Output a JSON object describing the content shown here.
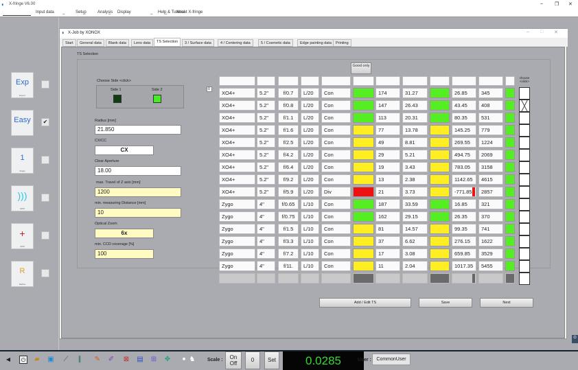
{
  "app": {
    "title": "X-fringe V6.00",
    "menu": [
      "Input data",
      "_",
      "Setup",
      "_",
      "Analysis",
      "_",
      "Display",
      "_",
      "Help & Tutorial",
      "_",
      "About X-fringe"
    ]
  },
  "window": {
    "title": "X-Job by XONOX",
    "tabs": [
      "Start",
      "General data",
      "Blank data",
      "Lens data",
      "TS Selection",
      "3 / Surface data",
      "4 / Centering data",
      "5 / Cosmetic data",
      "Edge painting data",
      "Printing"
    ],
    "active_tab": "TS Selection",
    "section": "TS Selection"
  },
  "tools": [
    {
      "label": "Exp",
      "sub": "Expert",
      "checked": false
    },
    {
      "label": "Easy",
      "sub": "",
      "checked": true
    },
    {
      "label": "1",
      "sub": "Single",
      "checked": false
    },
    {
      "label": "",
      "sub": "DPM",
      "checked": false
    },
    {
      "label": "+",
      "sub": "APM",
      "checked": false
    },
    {
      "label": "R",
      "sub": "Radius",
      "checked": false
    }
  ],
  "form": {
    "side_title": "Choose Side <click>",
    "side1": "Side 1",
    "side2": "Side 2",
    "selected_side": "Side 2",
    "radius_label": "Radius [mm]",
    "radius": "21.850",
    "cxcc_label": "CX/CC",
    "cxcc": "CX",
    "aperture_label": "Clear Aperture",
    "aperture": "18.00",
    "ztravel_label": "max. Travel of Z axis [mm]",
    "ztravel": "1200",
    "mindist_label": "min. measuring Distance [mm]",
    "mindist": "10",
    "zoom_label": "Optical Zoom",
    "zoom": "6x",
    "ccd_label": "min. CCD coverage [%]",
    "ccd": "100"
  },
  "table": {
    "good_only": "Good only",
    "choose_header": "choose <click>",
    "index": "0",
    "colors": {
      "G": "#55ee22",
      "Y": "#ffee22",
      "R": "#ee1111"
    },
    "rows": [
      [
        "XO4+",
        "5.2\"",
        "f/0.7",
        "L/20",
        "Con",
        "G",
        "174",
        "31.27",
        "G",
        "26.85",
        "345",
        "G",
        false
      ],
      [
        "XO4+",
        "5.2\"",
        "f/0.8",
        "L/20",
        "Con",
        "G",
        "147",
        "26.43",
        "G",
        "43.45",
        "408",
        "G",
        true
      ],
      [
        "XO4+",
        "5.2\"",
        "f/1.1",
        "L/20",
        "Con",
        "G",
        "113",
        "20.31",
        "G",
        "80.35",
        "531",
        "G",
        false
      ],
      [
        "XO4+",
        "5.2\"",
        "f/1.6",
        "L/20",
        "Con",
        "Y",
        "77",
        "13.78",
        "Y",
        "145.25",
        "779",
        "G",
        false
      ],
      [
        "XO4+",
        "5.2\"",
        "f/2.5",
        "L/20",
        "Con",
        "Y",
        "49",
        "8.81",
        "Y",
        "269.55",
        "1224",
        "G",
        false
      ],
      [
        "XO4+",
        "5.2\"",
        "f/4.2",
        "L/20",
        "Con",
        "Y",
        "29",
        "5.21",
        "Y",
        "494.75",
        "2069",
        "G",
        false
      ],
      [
        "XO4+",
        "5.2\"",
        "f/6.4",
        "L/20",
        "Con",
        "Y",
        "19",
        "3.43",
        "Y",
        "783.05",
        "3158",
        "G",
        false
      ],
      [
        "XO4+",
        "5.2\"",
        "f/9.2",
        "L/20",
        "Con",
        "Y",
        "13",
        "2.38",
        "Y",
        "1142.65",
        "4615",
        "G",
        false
      ],
      [
        "XO4+",
        "5.2\"",
        "f/5.9",
        "L/20",
        "Div",
        "R",
        "21",
        "3.73",
        "Y",
        "-771.85",
        "2857",
        "G",
        false
      ],
      [
        "Zygo",
        "4\"",
        "f/0.65",
        "L/10",
        "Con",
        "G",
        "187",
        "33.59",
        "G",
        "16.85",
        "321",
        "G",
        false
      ],
      [
        "Zygo",
        "4\"",
        "f/0.75",
        "L/10",
        "Con",
        "G",
        "162",
        "29.15",
        "G",
        "26.35",
        "370",
        "G",
        false
      ],
      [
        "Zygo",
        "4\"",
        "f/1.5",
        "L/10",
        "Con",
        "Y",
        "81",
        "14.57",
        "Y",
        "99.35",
        "741",
        "G",
        false
      ],
      [
        "Zygo",
        "4\"",
        "f/3.3",
        "L/10",
        "Con",
        "Y",
        "37",
        "6.62",
        "Y",
        "276.15",
        "1622",
        "G",
        false
      ],
      [
        "Zygo",
        "4\"",
        "f/7.2",
        "L/10",
        "Con",
        "Y",
        "17",
        "3.08",
        "Y",
        "659.85",
        "3529",
        "G",
        false
      ],
      [
        "Zygo",
        "4\"",
        "f/11.",
        "L/10",
        "Con",
        "Y",
        "11",
        "2.04",
        "Y",
        "1017.35",
        "5455",
        "G",
        false
      ]
    ]
  },
  "buttons": {
    "add_edit": "Add / Edit  TS",
    "save": "Save",
    "next": "Next"
  },
  "bottom": {
    "scale_label": "Scale :",
    "on": "On",
    "off": "Off",
    "zero": "0",
    "set": "Set",
    "readout": "0.0285",
    "user_label": "User :",
    "user": "CommonUser"
  }
}
